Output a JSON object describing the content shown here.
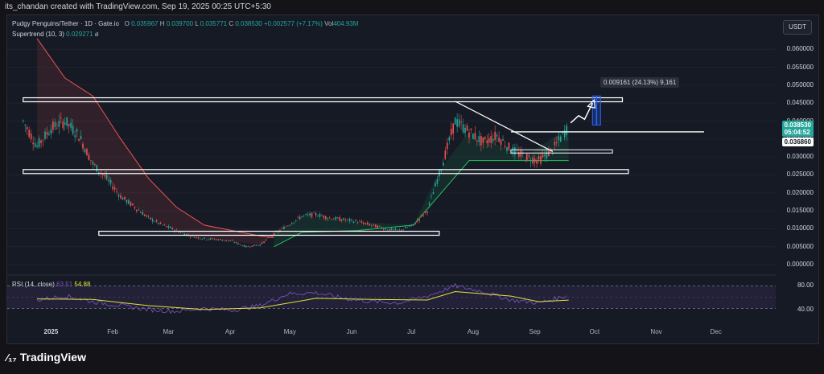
{
  "header": {
    "credit": "its_chandan created with TradingView.com, Sep 19, 2025 00:25 UTC+5:30"
  },
  "legend": {
    "symbol": "Pudgy Penguins/Tether · 1D · Gate.io",
    "open_label": "O",
    "open": "0.035967",
    "high_label": "H",
    "high": "0.039700",
    "low_label": "L",
    "low": "0.035771",
    "close_label": "C",
    "close": "0.038530",
    "change": "+0.002577 (+7.17%)",
    "vol_label": "Vol",
    "vol": "404.93M",
    "supertrend_label": "Supertrend (10, 3)",
    "supertrend_value": "0.029271",
    "supertrend_extra": "ø"
  },
  "currency_button": "USDT",
  "price_tags": {
    "last": "0.038530",
    "countdown": "05:04:52",
    "level": "0.036860"
  },
  "measure_label": "0.009161 (24.13%) 9,161",
  "rsi": {
    "label": "RSI (14, close)",
    "rsi_value": "63.51",
    "ma_value": "54.88",
    "upper": "80.00",
    "lower": "40.00"
  },
  "brand": "TradingView",
  "colors": {
    "up": "#26a69a",
    "down": "#ef5350",
    "supertrend_up": "#22c55e",
    "supertrend_down": "#ef5350",
    "rsi": "#7e57c2",
    "rsi_ma": "#e4e43a",
    "measure": "#2962ff"
  },
  "chart_data": {
    "type": "candlestick",
    "title": "Pudgy Penguins/Tether · 1D · Gate.io",
    "x_ticks": [
      "2025",
      "Feb",
      "Mar",
      "Apr",
      "May",
      "Jun",
      "Jul",
      "Aug",
      "Sep",
      "Oct",
      "Nov",
      "Dec"
    ],
    "y_ticks": [
      "0.060000",
      "0.055000",
      "0.050000",
      "0.045000",
      "0.040000",
      "0.035000",
      "0.030000",
      "0.025000",
      "0.020000",
      "0.015000",
      "0.010000",
      "0.005000",
      "0.000000"
    ],
    "ylim": [
      0,
      0.065
    ],
    "price_path": [
      [
        "2024-12-18",
        0.04
      ],
      [
        "2024-12-25",
        0.033
      ],
      [
        "2025-01-01",
        0.038
      ],
      [
        "2025-01-08",
        0.04
      ],
      [
        "2025-01-15",
        0.036
      ],
      [
        "2025-01-22",
        0.028
      ],
      [
        "2025-01-29",
        0.024
      ],
      [
        "2025-02-05",
        0.019
      ],
      [
        "2025-02-12",
        0.016
      ],
      [
        "2025-02-19",
        0.013
      ],
      [
        "2025-02-26",
        0.011
      ],
      [
        "2025-03-05",
        0.0095
      ],
      [
        "2025-03-12",
        0.008
      ],
      [
        "2025-03-19",
        0.0072
      ],
      [
        "2025-03-26",
        0.007
      ],
      [
        "2025-04-02",
        0.0065
      ],
      [
        "2025-04-09",
        0.005
      ],
      [
        "2025-04-16",
        0.0055
      ],
      [
        "2025-04-23",
        0.0085
      ],
      [
        "2025-04-30",
        0.011
      ],
      [
        "2025-05-07",
        0.0135
      ],
      [
        "2025-05-14",
        0.014
      ],
      [
        "2025-05-21",
        0.013
      ],
      [
        "2025-05-28",
        0.0125
      ],
      [
        "2025-06-04",
        0.012
      ],
      [
        "2025-06-11",
        0.011
      ],
      [
        "2025-06-18",
        0.01
      ],
      [
        "2025-06-25",
        0.0095
      ],
      [
        "2025-07-02",
        0.011
      ],
      [
        "2025-07-09",
        0.015
      ],
      [
        "2025-07-16",
        0.027
      ],
      [
        "2025-07-23",
        0.04
      ],
      [
        "2025-07-30",
        0.037
      ],
      [
        "2025-08-06",
        0.034
      ],
      [
        "2025-08-13",
        0.036
      ],
      [
        "2025-08-20",
        0.032
      ],
      [
        "2025-08-27",
        0.03
      ],
      [
        "2025-09-03",
        0.029
      ],
      [
        "2025-09-10",
        0.032
      ],
      [
        "2025-09-18",
        0.0385
      ]
    ],
    "supertrend_down": [
      [
        "2024-12-25",
        0.063
      ],
      [
        "2025-01-08",
        0.052
      ],
      [
        "2025-01-22",
        0.047
      ],
      [
        "2025-02-05",
        0.035
      ],
      [
        "2025-02-19",
        0.024
      ],
      [
        "2025-03-05",
        0.016
      ],
      [
        "2025-03-19",
        0.011
      ],
      [
        "2025-04-02",
        0.0095
      ],
      [
        "2025-04-16",
        0.008
      ],
      [
        "2025-04-23",
        0.0075
      ]
    ],
    "supertrend_up": [
      [
        "2025-04-23",
        0.005
      ],
      [
        "2025-05-07",
        0.009
      ],
      [
        "2025-06-04",
        0.0095
      ],
      [
        "2025-07-02",
        0.011
      ],
      [
        "2025-07-16",
        0.02
      ],
      [
        "2025-07-30",
        0.029
      ],
      [
        "2025-08-27",
        0.029
      ],
      [
        "2025-09-18",
        0.029
      ]
    ],
    "zones": [
      {
        "x0": "2024-12-18",
        "x1": "2025-10-15",
        "y0": 0.0455,
        "y1": 0.0465
      },
      {
        "x0": "2024-12-18",
        "x1": "2025-10-18",
        "y0": 0.0255,
        "y1": 0.0265
      },
      {
        "x0": "2025-01-25",
        "x1": "2025-07-15",
        "y0": 0.0088,
        "y1": 0.0093
      }
    ],
    "trendline": [
      [
        "2025-07-23",
        0.0455
      ],
      [
        "2025-09-10",
        0.0315
      ]
    ],
    "resistance_line": {
      "x0": "2025-08-20",
      "x1": "2025-11-25",
      "y": 0.037
    },
    "support_box": {
      "x0": "2025-08-20",
      "x1": "2025-10-10",
      "y0": 0.0315,
      "y1": 0.032
    },
    "measure_arrow": {
      "x": "2025-10-02",
      "y0": 0.0389,
      "y1": 0.047
    },
    "projection": [
      [
        "2025-09-19",
        0.0395
      ],
      [
        "2025-09-23",
        0.0415
      ],
      [
        "2025-09-26",
        0.0405
      ],
      [
        "2025-09-30",
        0.045
      ]
    ],
    "rsi_series": [
      [
        "2024-12-25",
        55
      ],
      [
        "2025-01-08",
        62
      ],
      [
        "2025-01-22",
        52
      ],
      [
        "2025-02-05",
        45
      ],
      [
        "2025-02-19",
        38
      ],
      [
        "2025-03-05",
        35
      ],
      [
        "2025-03-19",
        40
      ],
      [
        "2025-04-02",
        37
      ],
      [
        "2025-04-16",
        45
      ],
      [
        "2025-04-30",
        66
      ],
      [
        "2025-05-14",
        68
      ],
      [
        "2025-05-28",
        58
      ],
      [
        "2025-06-11",
        52
      ],
      [
        "2025-06-25",
        50
      ],
      [
        "2025-07-09",
        62
      ],
      [
        "2025-07-23",
        80
      ],
      [
        "2025-08-06",
        70
      ],
      [
        "2025-08-20",
        55
      ],
      [
        "2025-09-03",
        50
      ],
      [
        "2025-09-18",
        63.51
      ]
    ],
    "rsi_ma_series": [
      [
        "2024-12-25",
        57
      ],
      [
        "2025-01-22",
        56
      ],
      [
        "2025-02-19",
        45
      ],
      [
        "2025-03-19",
        38
      ],
      [
        "2025-04-16",
        41
      ],
      [
        "2025-05-14",
        58
      ],
      [
        "2025-06-11",
        56
      ],
      [
        "2025-07-09",
        55
      ],
      [
        "2025-07-23",
        70
      ],
      [
        "2025-08-20",
        62
      ],
      [
        "2025-09-03",
        52
      ],
      [
        "2025-09-18",
        54.88
      ]
    ],
    "rsi_ylim": [
      25,
      85
    ]
  }
}
